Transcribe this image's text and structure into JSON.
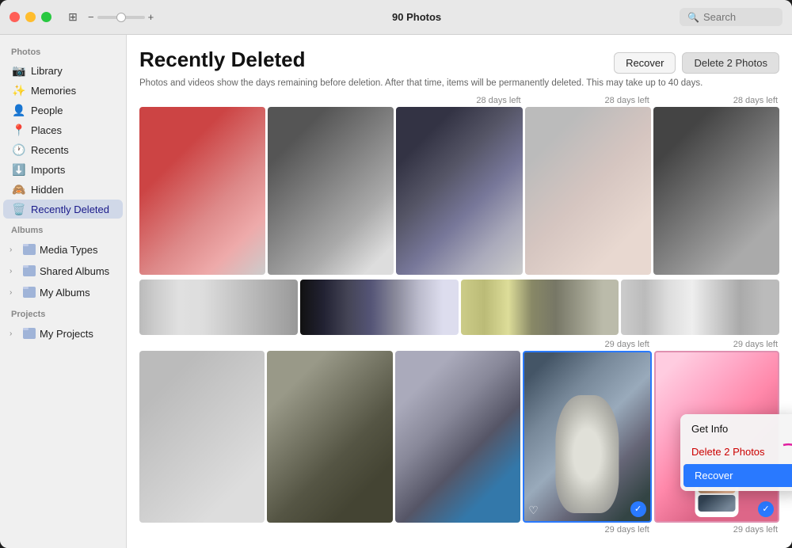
{
  "window": {
    "title": "90 Photos"
  },
  "titlebar": {
    "photo_count": "90 Photos",
    "search_placeholder": "Search",
    "zoom_minus": "−",
    "zoom_plus": "+"
  },
  "sidebar": {
    "photos_label": "Photos",
    "albums_label": "Albums",
    "projects_label": "Projects",
    "items": [
      {
        "id": "library",
        "label": "Library",
        "icon": "📷"
      },
      {
        "id": "memories",
        "label": "Memories",
        "icon": "✨"
      },
      {
        "id": "people",
        "label": "People",
        "icon": "👤"
      },
      {
        "id": "places",
        "label": "Places",
        "icon": "📍"
      },
      {
        "id": "recents",
        "label": "Recents",
        "icon": "🕐"
      },
      {
        "id": "imports",
        "label": "Imports",
        "icon": "⬇️"
      },
      {
        "id": "hidden",
        "label": "Hidden",
        "icon": "🙈"
      },
      {
        "id": "recently-deleted",
        "label": "Recently Deleted",
        "icon": "🗑️",
        "active": true
      }
    ],
    "album_groups": [
      {
        "id": "media-types",
        "label": "Media Types"
      },
      {
        "id": "shared-albums",
        "label": "Shared Albums"
      },
      {
        "id": "my-albums",
        "label": "My Albums"
      }
    ],
    "project_groups": [
      {
        "id": "my-projects",
        "label": "My Projects"
      }
    ]
  },
  "content": {
    "title": "Recently Deleted",
    "subtitle": "Photos and videos show the days remaining before deletion. After that time, items will be permanently deleted. This may take up to 40 days.",
    "recover_button": "Recover",
    "delete_button": "Delete 2 Photos"
  },
  "grid": {
    "row1_labels": [
      "28 days left",
      "28 days left",
      "28 days left"
    ],
    "row3_bottom_labels": [
      "29 days left",
      "29 days left"
    ]
  },
  "context_menu": {
    "items": [
      {
        "id": "get-info",
        "label": "Get Info",
        "active": false
      },
      {
        "id": "delete",
        "label": "Delete 2 Photos",
        "active": false,
        "danger": true
      },
      {
        "id": "recover",
        "label": "Recover",
        "active": true
      }
    ]
  }
}
